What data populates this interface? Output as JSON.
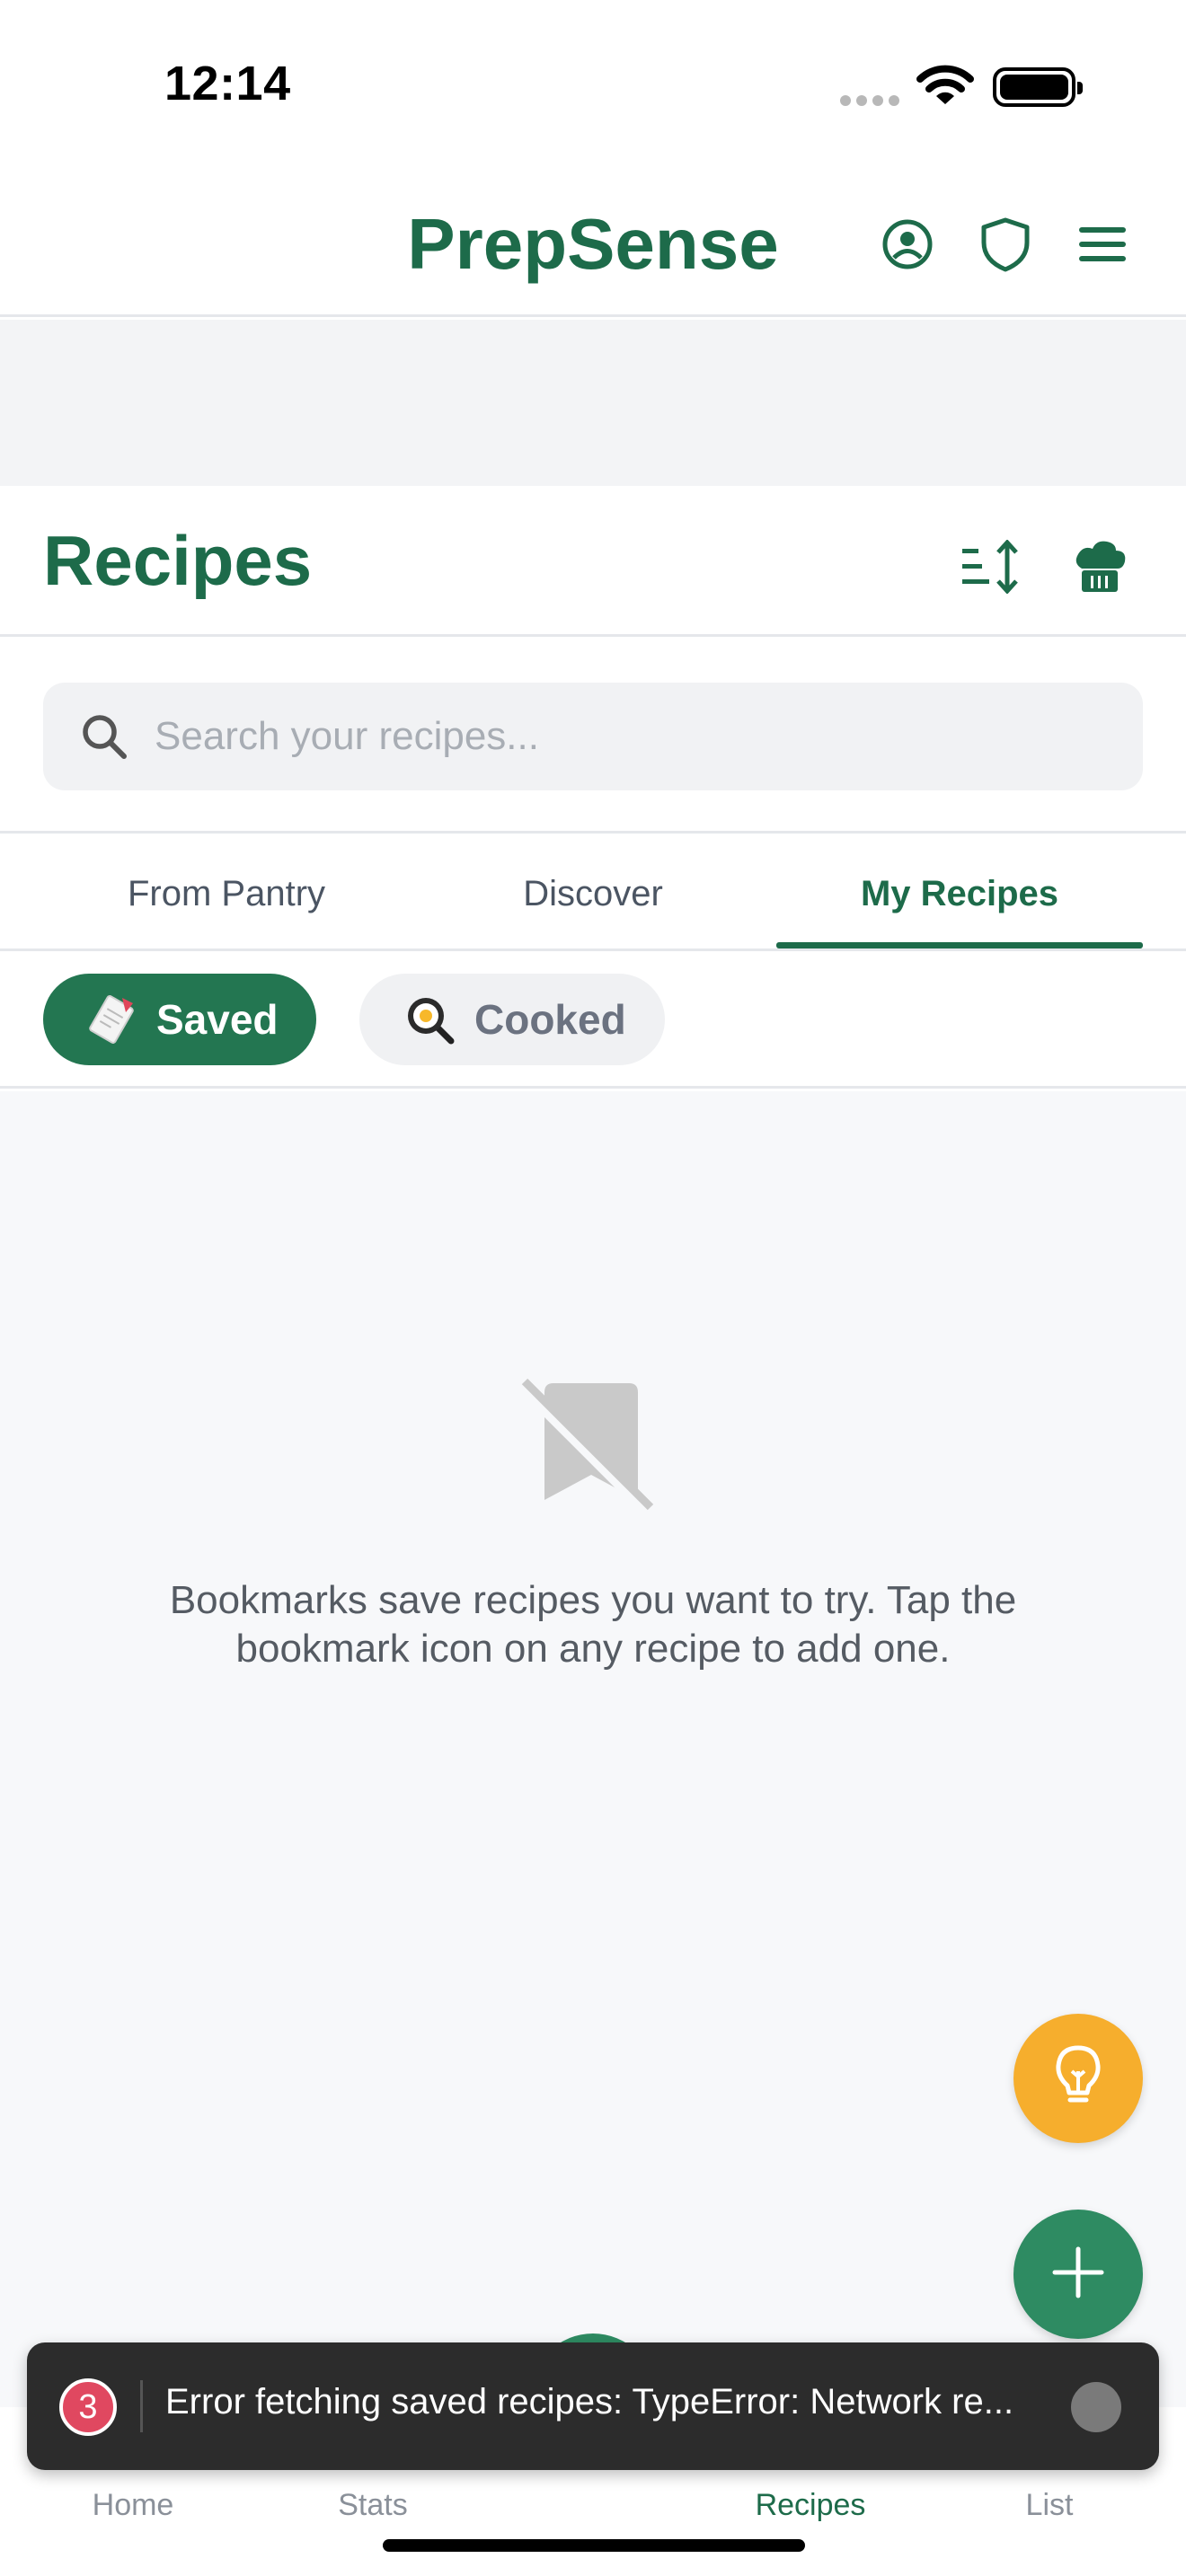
{
  "status_bar": {
    "time": "12:14"
  },
  "header": {
    "brand": "PrepSense",
    "icons": [
      "user-circle-icon",
      "shield-icon",
      "menu-icon"
    ]
  },
  "recipes": {
    "title": "Recipes",
    "actions": [
      "sort-icon",
      "chef-hat-icon"
    ]
  },
  "search": {
    "placeholder": "Search your recipes...",
    "value": ""
  },
  "tabs": {
    "items": [
      {
        "label": "From Pantry"
      },
      {
        "label": "Discover"
      },
      {
        "label": "My Recipes"
      }
    ],
    "active": "My Recipes"
  },
  "filters": {
    "saved": {
      "label": "Saved",
      "emoji": "🗒️"
    },
    "cooked": {
      "label": "Cooked",
      "emoji": "🍳"
    },
    "active": "Saved"
  },
  "empty_state": {
    "icon": "bookmark-off-icon",
    "message": "Bookmarks save recipes you want to try. Tap the bookmark icon on any recipe to add one."
  },
  "fabs": [
    "lightbulb-icon",
    "plus-icon"
  ],
  "bottom_nav": {
    "items": [
      {
        "label": "Home"
      },
      {
        "label": "Stats"
      },
      {
        "label": "Recipes"
      },
      {
        "label": "List"
      }
    ],
    "active": "Recipes"
  },
  "toast": {
    "count": "3",
    "message": "Error fetching saved recipes: TypeError: Network re..."
  },
  "colors": {
    "brand": "#1d6b4a",
    "chip_active": "#237651",
    "fab_add": "#2e8b62",
    "fab_tip": "#f6ae2d",
    "toast_badge": "#e04860",
    "toast_bg": "#2c2c2c"
  }
}
